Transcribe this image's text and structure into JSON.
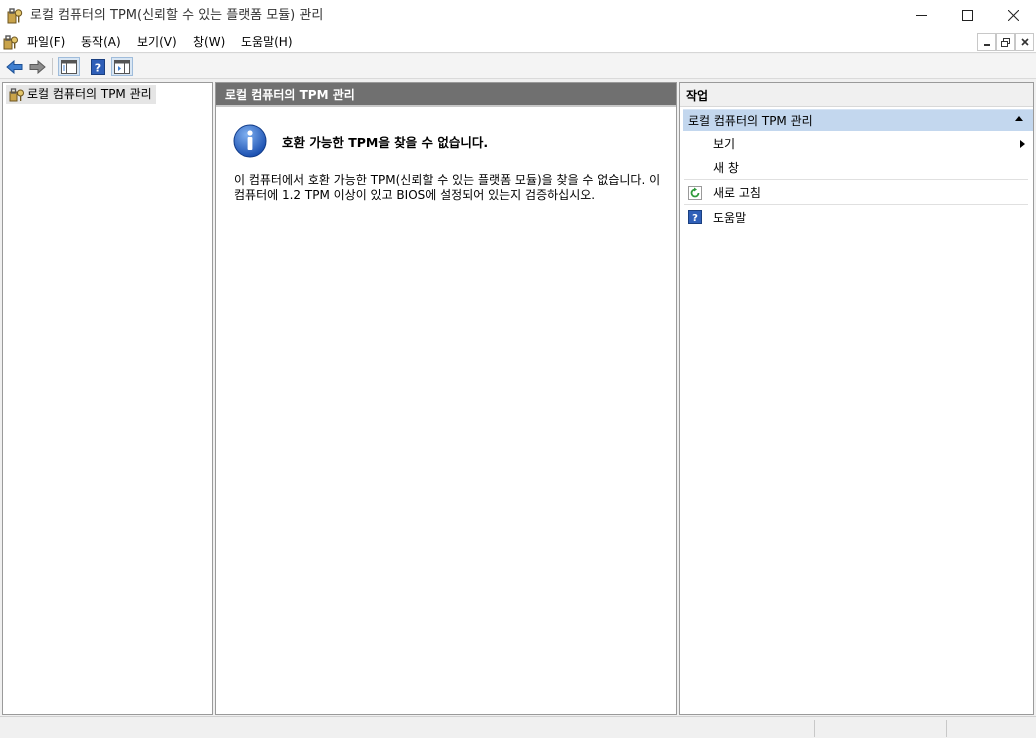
{
  "window": {
    "title": "로컬 컴퓨터의 TPM(신뢰할 수 있는 플랫폼 모듈) 관리",
    "controls": [
      "minimize-icon",
      "maximize-icon",
      "close-icon"
    ]
  },
  "menu": {
    "file": "파일(F)",
    "action": "동작(A)",
    "view": "보기(V)",
    "window": "창(W)",
    "help": "도움말(H)"
  },
  "toolbar": {
    "icons": [
      "back-arrow-icon",
      "forward-arrow-icon",
      "show-tree-icon",
      "help-icon",
      "show-action-pane-icon"
    ]
  },
  "tree": {
    "root_label": "로컬 컴퓨터의 TPM 관리"
  },
  "center": {
    "header": "로컬 컴퓨터의 TPM 관리",
    "message_title": "호환 가능한 TPM을 찾을 수 없습니다.",
    "message_body": "이 컴퓨터에서 호환 가능한 TPM(신뢰할 수 있는 플랫폼 모듈)을 찾을 수 없습니다. 이 컴퓨터에 1.2 TPM 이상이 있고 BIOS에 설정되어 있는지 검증하십시오."
  },
  "actions": {
    "header": "작업",
    "group_title": "로컬 컴퓨터의 TPM 관리",
    "items": [
      {
        "label": "보기",
        "icon": "",
        "submenu": true
      },
      {
        "label": "새 창",
        "icon": "",
        "submenu": false
      },
      {
        "label": "새로 고침",
        "icon": "refresh-icon",
        "submenu": false
      },
      {
        "label": "도움말",
        "icon": "help-icon",
        "submenu": false
      }
    ]
  },
  "colors": {
    "accent_selection": "#c3d7ee",
    "center_header_bg": "#707070",
    "info_blue": "#1f5fbf"
  }
}
